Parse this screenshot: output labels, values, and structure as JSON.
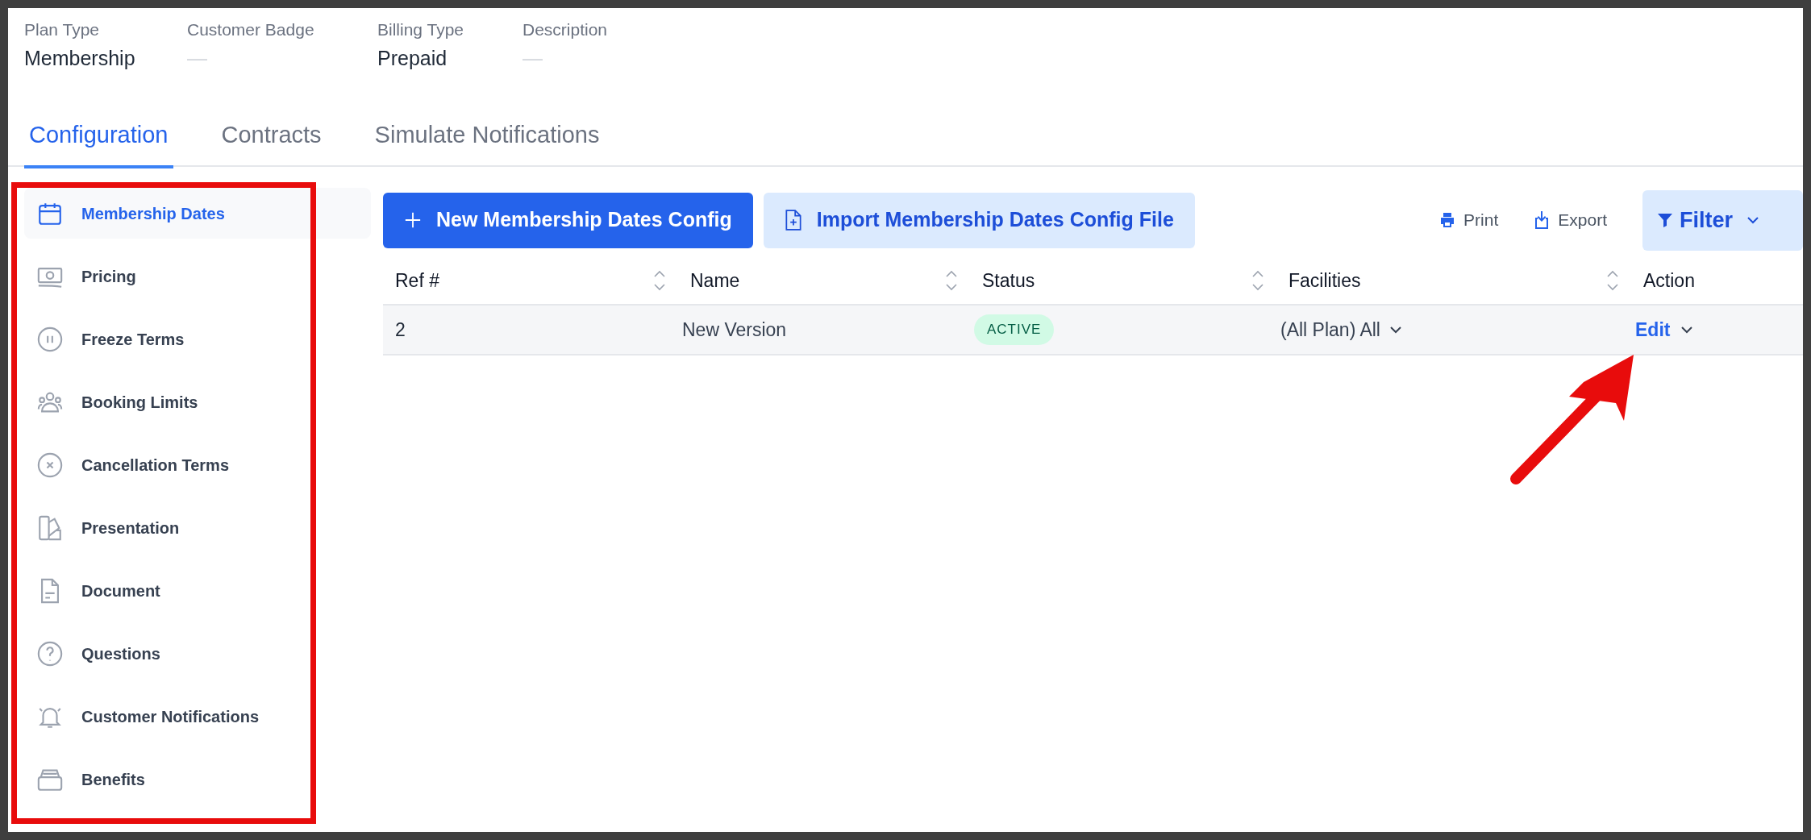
{
  "summary": [
    {
      "label": "Plan Type",
      "value": "Membership",
      "empty": false
    },
    {
      "label": "Customer Badge",
      "value": "—",
      "empty": true
    },
    {
      "label": "Billing Type",
      "value": "Prepaid",
      "empty": false
    },
    {
      "label": "Description",
      "value": "—",
      "empty": true
    }
  ],
  "tabs": [
    {
      "label": "Configuration",
      "selected": true
    },
    {
      "label": "Contracts",
      "selected": false
    },
    {
      "label": "Simulate Notifications",
      "selected": false
    }
  ],
  "sidebar": {
    "items": [
      {
        "label": "Membership Dates",
        "selected": true
      },
      {
        "label": "Pricing",
        "selected": false
      },
      {
        "label": "Freeze Terms",
        "selected": false
      },
      {
        "label": "Booking Limits",
        "selected": false
      },
      {
        "label": "Cancellation Terms",
        "selected": false
      },
      {
        "label": "Presentation",
        "selected": false
      },
      {
        "label": "Document",
        "selected": false
      },
      {
        "label": "Questions",
        "selected": false
      },
      {
        "label": "Customer Notifications",
        "selected": false
      },
      {
        "label": "Benefits",
        "selected": false
      }
    ]
  },
  "toolbar": {
    "buttons": [
      {
        "label": "New Membership Dates Config",
        "kind": "primary"
      },
      {
        "label": "Import Membership Dates Config File",
        "kind": "secondary"
      }
    ],
    "actions": [
      {
        "label": "Print",
        "kind": "print"
      },
      {
        "label": "Export",
        "kind": "export"
      }
    ],
    "filter": "Filter"
  },
  "table": {
    "columns": [
      {
        "label": "Ref #",
        "sortable": true
      },
      {
        "label": "Name",
        "sortable": true
      },
      {
        "label": "Status",
        "sortable": true
      },
      {
        "label": "Facilities",
        "sortable": true
      },
      {
        "label": "Action",
        "sortable": false
      }
    ],
    "rows": [
      {
        "ref": "2",
        "name": "New Version",
        "status": "ACTIVE",
        "facilities": "(All Plan) All",
        "action": "Edit"
      }
    ]
  }
}
